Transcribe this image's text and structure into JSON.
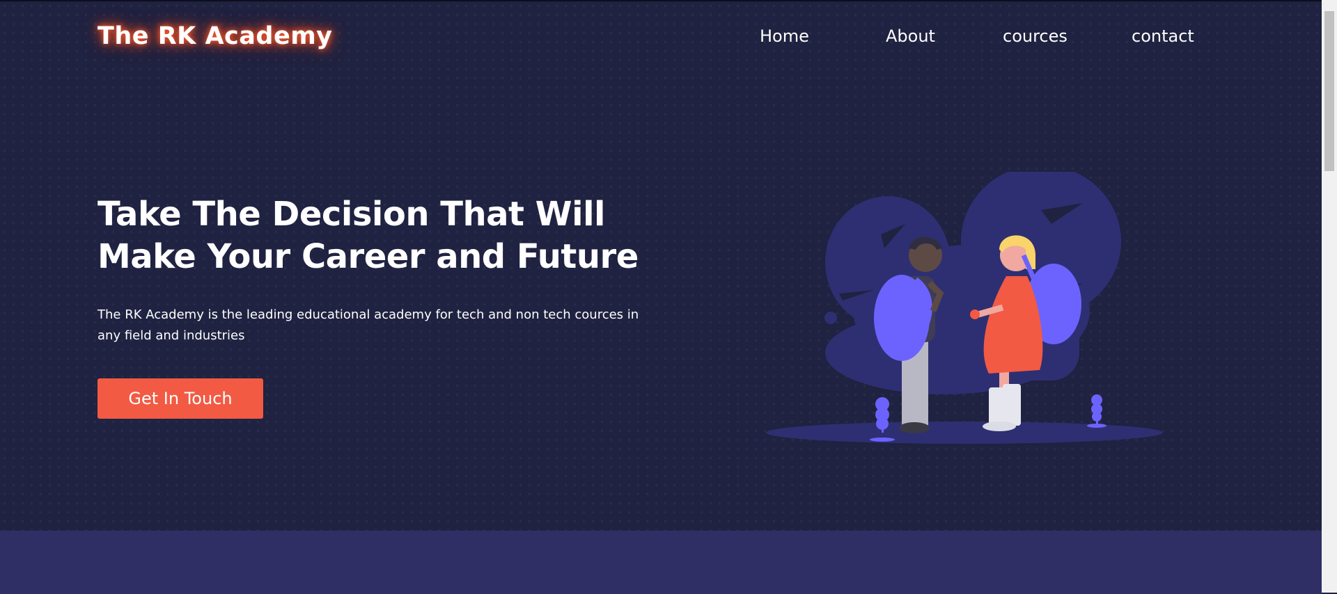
{
  "header": {
    "logo": "The RK Academy",
    "nav": [
      {
        "label": "Home"
      },
      {
        "label": "About"
      },
      {
        "label": "cources"
      },
      {
        "label": "contact"
      }
    ]
  },
  "hero": {
    "headline": "Take The Decision That Will Make Your Career and Future",
    "description": "The RK Academy is the leading educational academy for tech and non tech cources in any field and industries",
    "cta_label": "Get In Touch",
    "illustration": "students-with-backpacks-illustration"
  },
  "colors": {
    "background": "#1f2240",
    "accent": "#f25a43",
    "illustration_purple": "#6c63ff",
    "lower_band": "#2f2f66"
  }
}
